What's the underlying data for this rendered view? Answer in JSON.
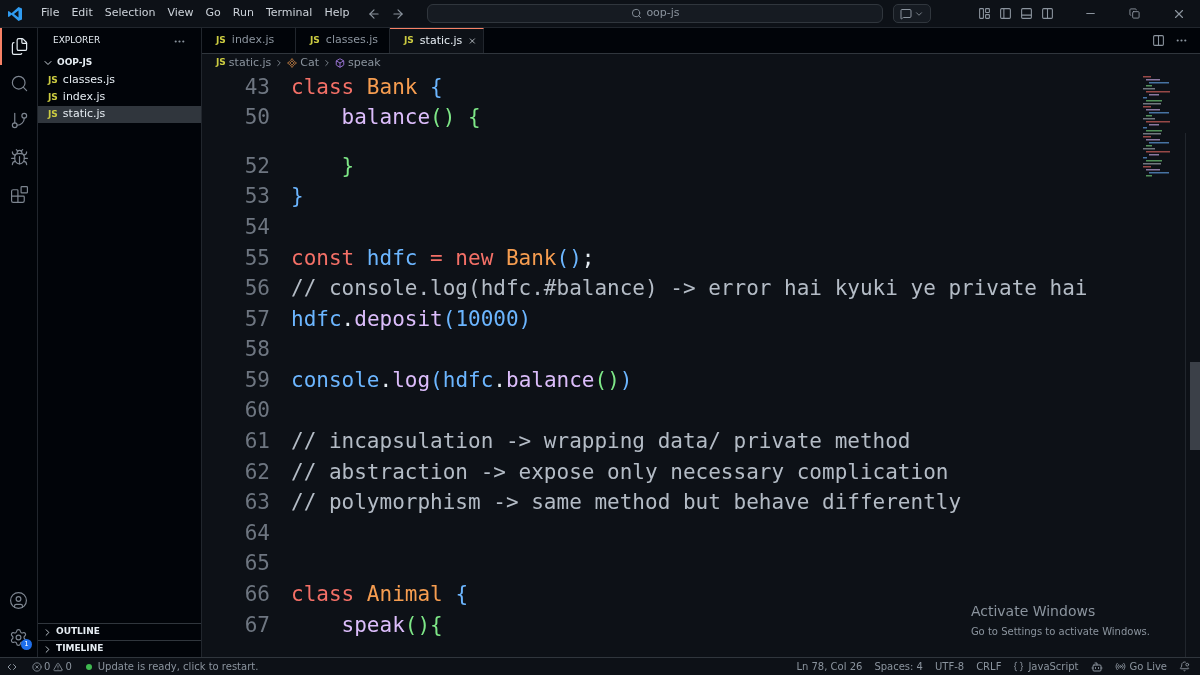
{
  "menu": [
    "File",
    "Edit",
    "Selection",
    "View",
    "Go",
    "Run",
    "Terminal",
    "Help"
  ],
  "search": {
    "value": "oop-js"
  },
  "activity_bar": [
    {
      "kind": "files",
      "selected": true
    },
    {
      "kind": "search",
      "selected": false
    },
    {
      "kind": "source-control",
      "selected": false
    },
    {
      "kind": "run",
      "selected": false
    },
    {
      "kind": "extensions",
      "selected": false
    }
  ],
  "settings_badge": "1",
  "explorer": {
    "title": "EXPLORER",
    "folder": {
      "name": "OOP-JS",
      "expanded": true,
      "children": [
        {
          "icon": "JS",
          "name": "classes.js",
          "selected": false
        },
        {
          "icon": "JS",
          "name": "index.js",
          "selected": false
        },
        {
          "icon": "JS",
          "name": "static.js",
          "selected": true
        }
      ]
    },
    "sections": [
      {
        "name": "OUTLINE",
        "expanded": false
      },
      {
        "name": "TIMELINE",
        "expanded": false
      }
    ]
  },
  "tabs": [
    {
      "icon": "JS",
      "label": "index.js",
      "selected": false
    },
    {
      "icon": "JS",
      "label": "classes.js",
      "selected": false
    },
    {
      "icon": "JS",
      "label": "static.js",
      "selected": true
    }
  ],
  "breadcrumb": {
    "icon": "JS",
    "file": "static.js",
    "class": "Cat",
    "method": "speak"
  },
  "sticky_lines": [
    {
      "n": "43",
      "tokens": [
        {
          "t": "class",
          "color": "#f47067"
        },
        {
          "t": " Bank",
          "color": "#f69d50"
        },
        {
          "t": " {",
          "color": "#6cb6ff"
        }
      ]
    },
    {
      "n": "50",
      "tokens": [
        {
          "t": "    balance",
          "color": "#dcbdfb"
        },
        {
          "t": "() {",
          "color": "#7ee787"
        }
      ]
    }
  ],
  "lines": [
    {
      "n": "52",
      "tokens": [
        {
          "t": "    }",
          "color": "#7ee787"
        }
      ]
    },
    {
      "n": "53",
      "tokens": [
        {
          "t": "}",
          "color": "#6cb6ff"
        }
      ]
    },
    {
      "n": "54"
    },
    {
      "n": "55",
      "tokens": [
        {
          "t": "const",
          "color": "#f47067"
        },
        {
          "t": " hdfc",
          "color": "#6cb6ff"
        },
        {
          "t": " = new",
          "color": "#f47067"
        },
        {
          "t": " Bank",
          "color": "#f69d50"
        },
        {
          "t": "()",
          "color": "#6cb6ff"
        },
        {
          "t": ";",
          "color": "#e6edf3"
        }
      ]
    },
    {
      "n": "56",
      "tokens": [
        {
          "t": "// console.log(hdfc.#balance) -> error hai kyuki ye private hai",
          "color": "#b4bcc6"
        }
      ]
    },
    {
      "n": "57",
      "tokens": [
        {
          "t": "hdfc",
          "color": "#6cb6ff"
        },
        {
          "t": ".",
          "color": "#e6edf3"
        },
        {
          "t": "deposit",
          "color": "#dcbdfb"
        },
        {
          "t": "(10000)",
          "color": "#6cb6ff"
        }
      ]
    },
    {
      "n": "58"
    },
    {
      "n": "59",
      "tokens": [
        {
          "t": "console",
          "color": "#6cb6ff"
        },
        {
          "t": ".",
          "color": "#e6edf3"
        },
        {
          "t": "log",
          "color": "#dcbdfb"
        },
        {
          "t": "(hdfc",
          "color": "#6cb6ff"
        },
        {
          "t": ".",
          "color": "#e6edf3"
        },
        {
          "t": "balance",
          "color": "#dcbdfb"
        },
        {
          "t": "()",
          "color": "#7ee787"
        },
        {
          "t": ")",
          "color": "#6cb6ff"
        }
      ]
    },
    {
      "n": "60"
    },
    {
      "n": "61",
      "tokens": [
        {
          "t": "// incapsulation -> wrapping data/ private method",
          "color": "#b4bcc6"
        }
      ]
    },
    {
      "n": "62",
      "tokens": [
        {
          "t": "// abstraction -> expose only necessary complication",
          "color": "#b4bcc6"
        }
      ]
    },
    {
      "n": "63",
      "tokens": [
        {
          "t": "// polymorphism -> same method but behave differently",
          "color": "#b4bcc6"
        }
      ]
    },
    {
      "n": "64"
    },
    {
      "n": "65"
    },
    {
      "n": "66",
      "tokens": [
        {
          "t": "class",
          "color": "#f47067"
        },
        {
          "t": " Animal",
          "color": "#f69d50"
        },
        {
          "t": " {",
          "color": "#6cb6ff"
        }
      ]
    },
    {
      "n": "67",
      "tokens": [
        {
          "t": "    speak",
          "color": "#dcbdfb"
        },
        {
          "t": "(){",
          "color": "#7ee787"
        }
      ]
    }
  ],
  "activation": {
    "title": "Activate Windows",
    "text": "Go to Settings to activate Windows."
  },
  "status_bar": {
    "errors": "0",
    "warnings": "0",
    "message": "Update is ready, click to restart.",
    "position": "Ln 78, Col 26",
    "spaces": "Spaces: 4",
    "encoding": "UTF-8",
    "eol": "CRLF",
    "language": "JavaScript",
    "live": "Go Live"
  }
}
